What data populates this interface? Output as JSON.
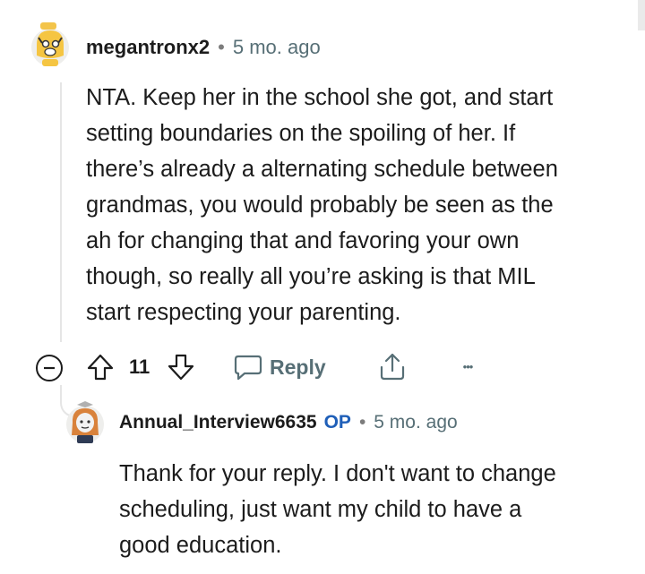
{
  "comments": [
    {
      "username": "megantronx2",
      "separator": "•",
      "time": "5 mo. ago",
      "lines": [
        "NTA. Keep her in the school she got, and start",
        "setting boundaries on the spoiling of her. If",
        "there’s already a alternating schedule between",
        "grandmas, you would probably be seen as the",
        "ah for changing that and favoring your own",
        "though, so really all you’re asking is that MIL",
        "start respecting your parenting."
      ],
      "actions": {
        "collapse_icon": "collapse-icon",
        "upvote_icon": "upvote-arrow-icon",
        "score": "11",
        "downvote_icon": "downvote-arrow-icon",
        "reply_icon": "speech-bubble-icon",
        "reply_label": "Reply",
        "share_icon": "share-icon",
        "more_icon": "more-options-icon",
        "more_glyph": "•••"
      }
    },
    {
      "username": "Annual_Interview6635",
      "badge": "OP",
      "separator": "•",
      "time": "5 mo. ago",
      "lines": [
        "Thank for your reply. I don't want to change",
        "scheduling, just want my child to have a",
        "good education."
      ]
    }
  ],
  "colors": {
    "text": "#1c1c1c",
    "muted": "#576f76",
    "op_badge": "#1f5fb8",
    "thread_line": "#e5e5e5"
  }
}
